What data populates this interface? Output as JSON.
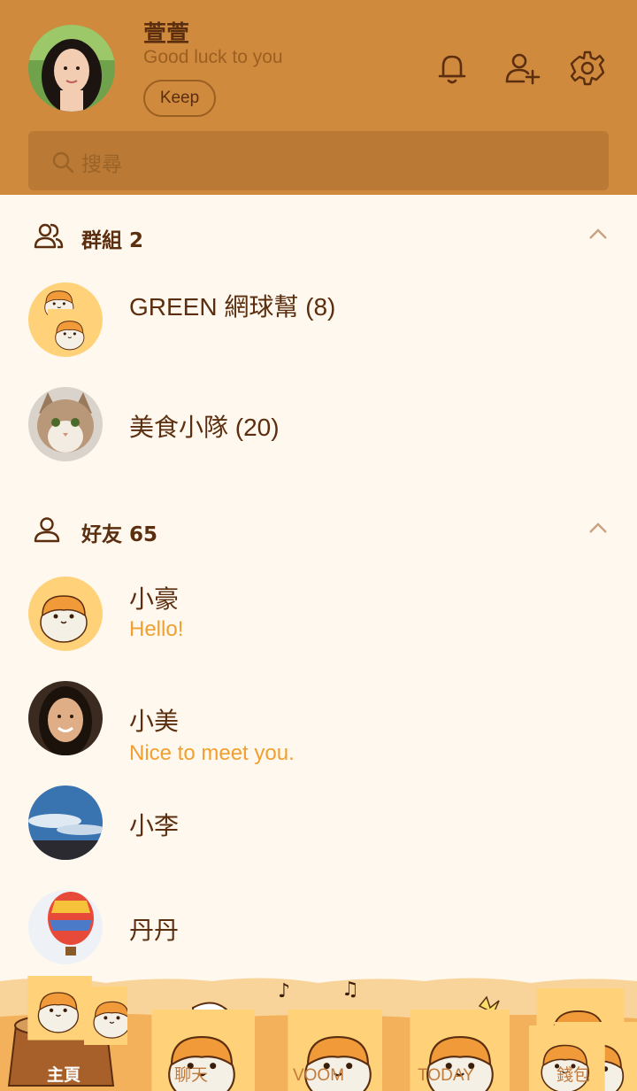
{
  "profile": {
    "name": "萱萱",
    "status": "Good luck to you",
    "keep_label": "Keep"
  },
  "search": {
    "placeholder": "搜尋"
  },
  "groups": {
    "title": "群組 2",
    "items": [
      {
        "name": "GREEN 網球幫 (8)"
      },
      {
        "name": "美食小隊 (20)"
      }
    ]
  },
  "friends": {
    "title": "好友 65",
    "items": [
      {
        "name": "小豪",
        "status": "Hello!"
      },
      {
        "name": "小美",
        "status": "Nice to meet you."
      },
      {
        "name": "小李",
        "status": ""
      },
      {
        "name": "丹丹",
        "status": ""
      }
    ]
  },
  "nav": {
    "items": [
      {
        "label": "主頁",
        "active": true
      },
      {
        "label": "聊天"
      },
      {
        "label": "VOOM"
      },
      {
        "label": "TODAY"
      },
      {
        "label": "錢包"
      }
    ]
  },
  "colors": {
    "header_bg": "#d08a3e",
    "page_bg": "#fff8ee",
    "text_dark": "#5b2e0f",
    "status_text": "#f0a030",
    "hamster_orange": "#f09a3a"
  }
}
